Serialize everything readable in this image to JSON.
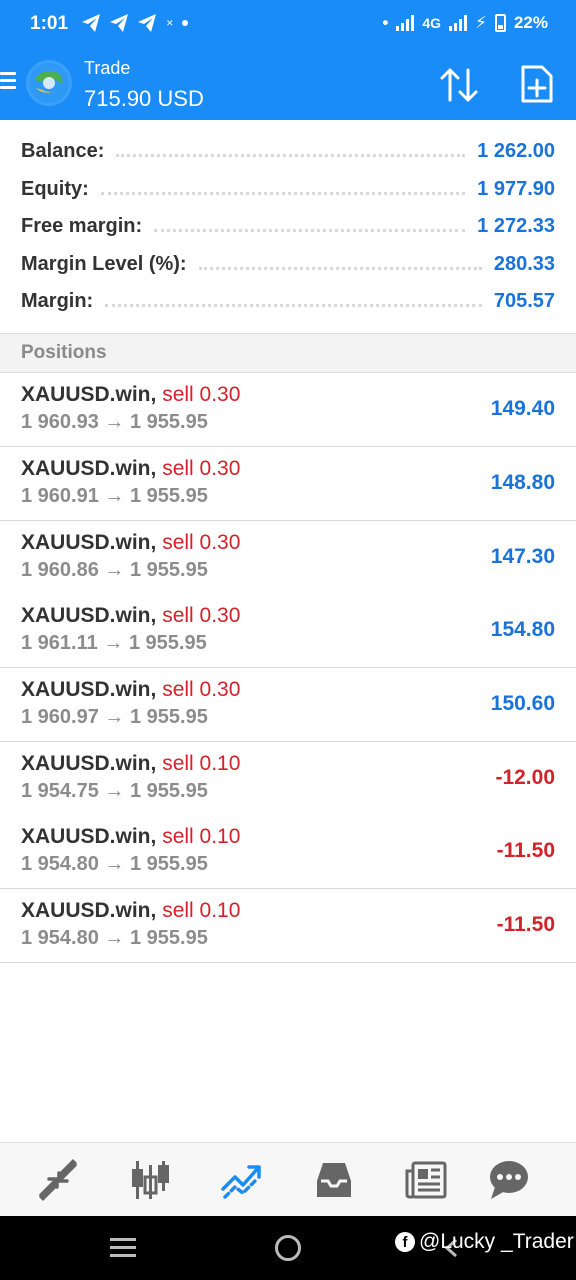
{
  "status_bar": {
    "time": "1:01",
    "network": "4G",
    "battery": "22%"
  },
  "header": {
    "title": "Trade",
    "subtitle": "715.90 USD"
  },
  "summary": [
    {
      "label": "Balance:",
      "value": "1 262.00"
    },
    {
      "label": "Equity:",
      "value": "1 977.90"
    },
    {
      "label": "Free margin:",
      "value": "1 272.33"
    },
    {
      "label": "Margin Level (%):",
      "value": "280.33"
    },
    {
      "label": "Margin:",
      "value": "705.57"
    }
  ],
  "positions_header": "Positions",
  "positions": [
    {
      "symbol": "XAUUSD.win,",
      "side": "sell 0.30",
      "open": "1 960.93",
      "arrow": "→",
      "current": "1 955.95",
      "profit": "149.40"
    },
    {
      "symbol": "XAUUSD.win,",
      "side": "sell 0.30",
      "open": "1 960.91",
      "arrow": "→",
      "current": "1 955.95",
      "profit": "148.80"
    },
    {
      "symbol": "XAUUSD.win,",
      "side": "sell 0.30",
      "open": "1 960.86",
      "arrow": "→",
      "current": "1 955.95",
      "profit": "147.30"
    },
    {
      "symbol": "XAUUSD.win,",
      "side": "sell 0.30",
      "open": "1 961.11",
      "arrow": "→",
      "current": "1 955.95",
      "profit": "154.80"
    },
    {
      "symbol": "XAUUSD.win,",
      "side": "sell 0.30",
      "open": "1 960.97",
      "arrow": "→",
      "current": "1 955.95",
      "profit": "150.60"
    },
    {
      "symbol": "XAUUSD.win,",
      "side": "sell 0.10",
      "open": "1 954.75",
      "arrow": "→",
      "current": "1 955.95",
      "profit": "-12.00"
    },
    {
      "symbol": "XAUUSD.win,",
      "side": "sell 0.10",
      "open": "1 954.80",
      "arrow": "→",
      "current": "1 955.95",
      "profit": "-11.50"
    },
    {
      "symbol": "XAUUSD.win,",
      "side": "sell 0.10",
      "open": "1 954.80",
      "arrow": "→",
      "current": "1 955.95",
      "profit": "-11.50"
    }
  ],
  "tabs": [
    {
      "name": "quotes",
      "icon": "quotes-icon"
    },
    {
      "name": "chart",
      "icon": "candlestick-icon"
    },
    {
      "name": "trade",
      "icon": "trade-icon",
      "active": true
    },
    {
      "name": "history",
      "icon": "inbox-icon"
    },
    {
      "name": "news",
      "icon": "news-icon"
    },
    {
      "name": "messages",
      "icon": "chat-icon"
    }
  ],
  "watermark": "@Lucky _Trader",
  "colors": {
    "accent": "#1a8cf7",
    "profit_positive": "#1a73d9",
    "profit_negative": "#d3222a",
    "sell": "#d3222a"
  }
}
